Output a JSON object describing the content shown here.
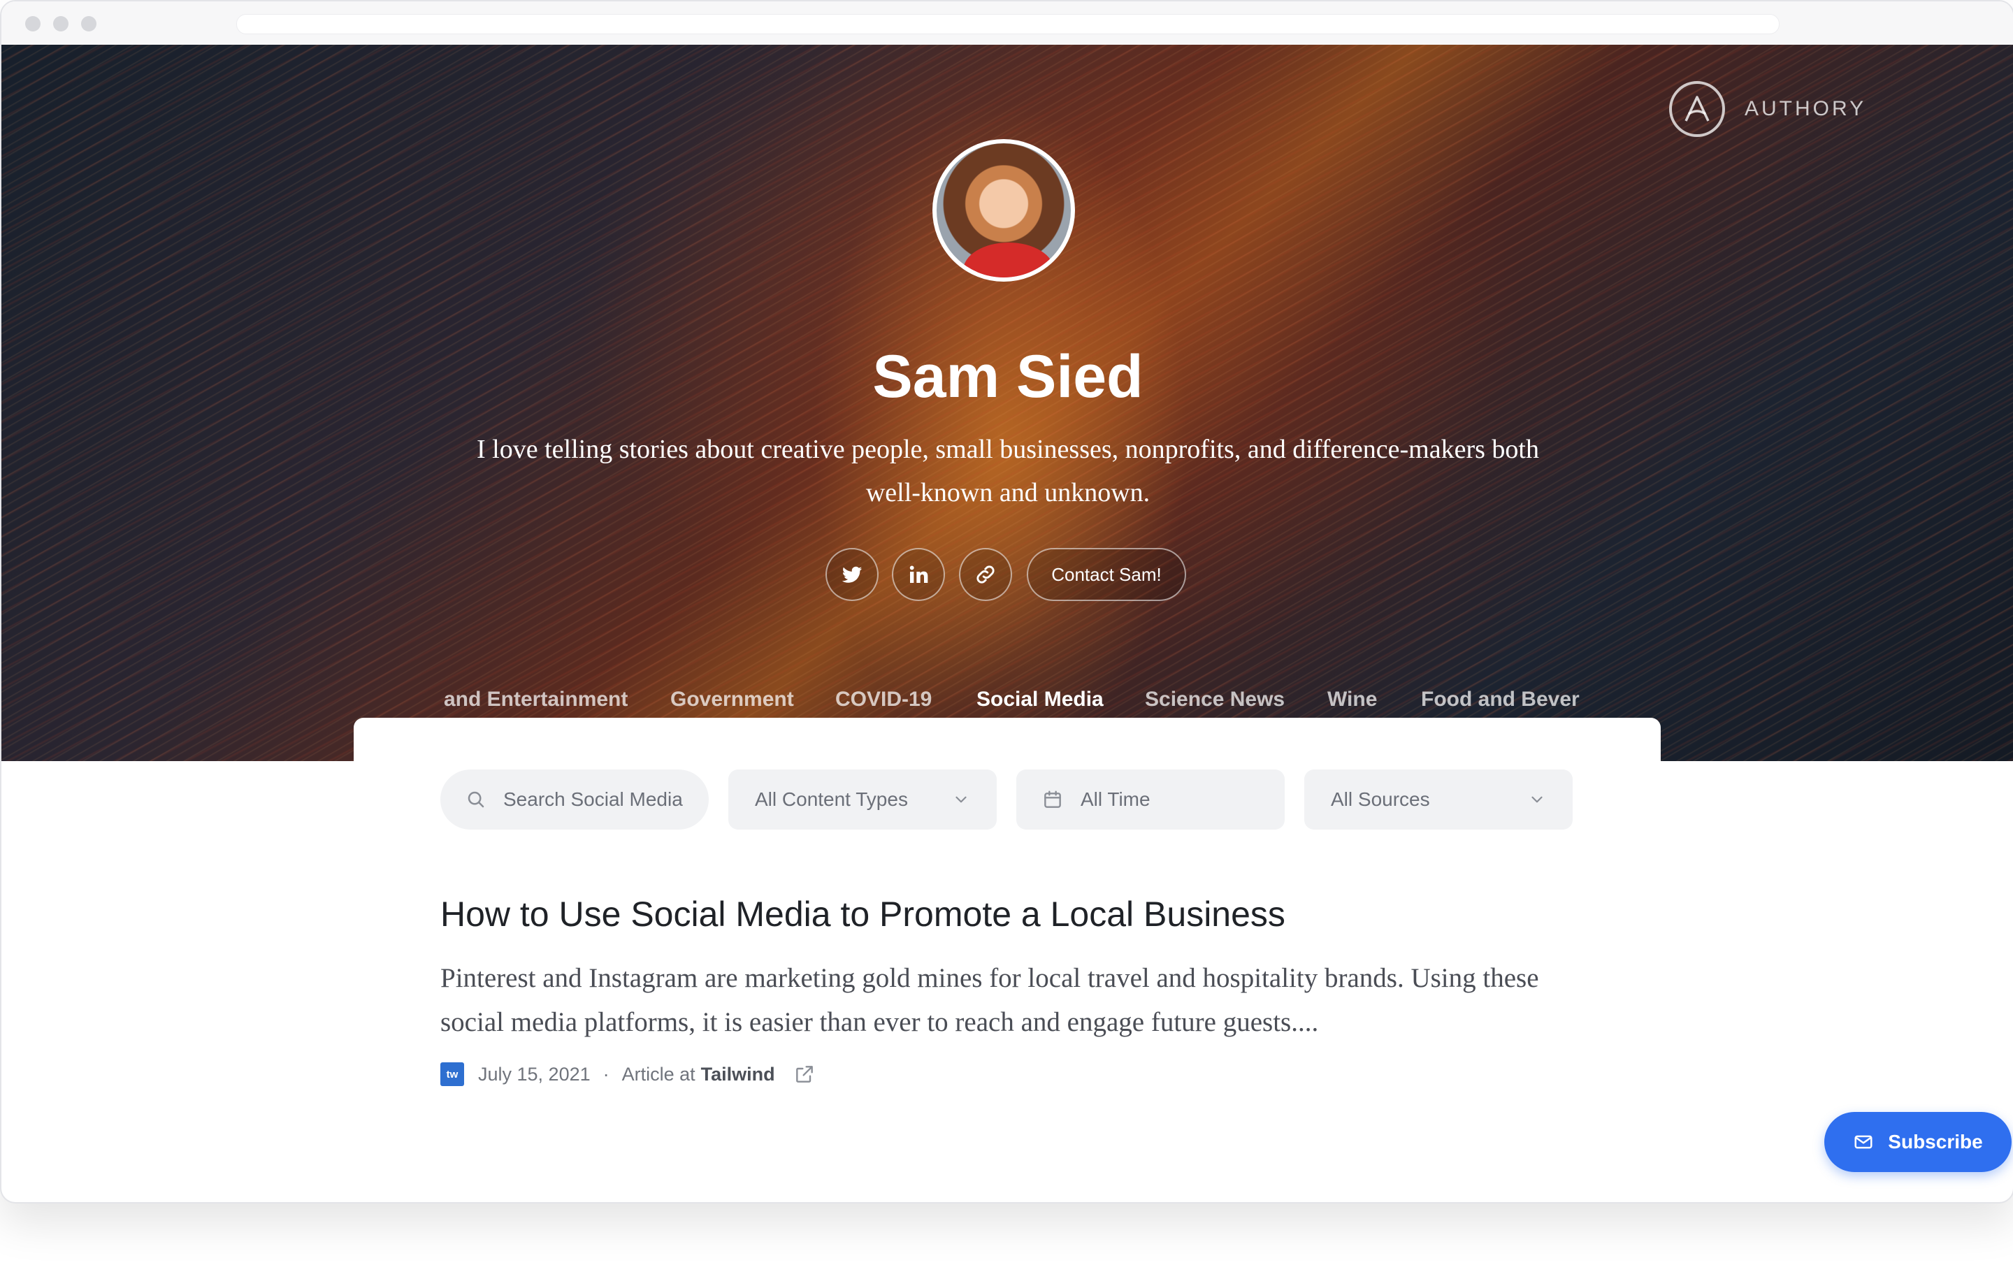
{
  "brand": {
    "name": "AUTHORY"
  },
  "profile": {
    "name": "Sam Sied",
    "bio": "I love telling stories about creative people, small businesses, nonprofits, and difference-makers both well-known and unknown.",
    "contact_label": "Contact Sam!"
  },
  "social": [
    {
      "icon": "twitter-icon"
    },
    {
      "icon": "linkedin-icon"
    },
    {
      "icon": "link-icon"
    }
  ],
  "tabs": [
    {
      "label": "and Entertainment",
      "active": false
    },
    {
      "label": "Government",
      "active": false
    },
    {
      "label": "COVID-19",
      "active": false
    },
    {
      "label": "Social Media",
      "active": true
    },
    {
      "label": "Science News",
      "active": false
    },
    {
      "label": "Wine",
      "active": false
    },
    {
      "label": "Food and Bever",
      "active": false
    }
  ],
  "filters": {
    "search_placeholder": "Search Social Media",
    "content_types": "All Content Types",
    "time": "All Time",
    "sources": "All Sources"
  },
  "article": {
    "title": "How to Use Social Media to Promote a Local Business",
    "excerpt": "Pinterest and Instagram are marketing gold mines for local travel and hospitality brands. Using these social media platforms, it is easier than ever to reach and engage future guests....",
    "source_logo_text": "tw",
    "date": "July 15, 2021",
    "separator": "·",
    "type_prefix": "Article at",
    "source": "Tailwind"
  },
  "subscribe_label": "Subscribe",
  "colors": {
    "accent": "#2f6fef",
    "tab_underline": "#3f7dff"
  }
}
